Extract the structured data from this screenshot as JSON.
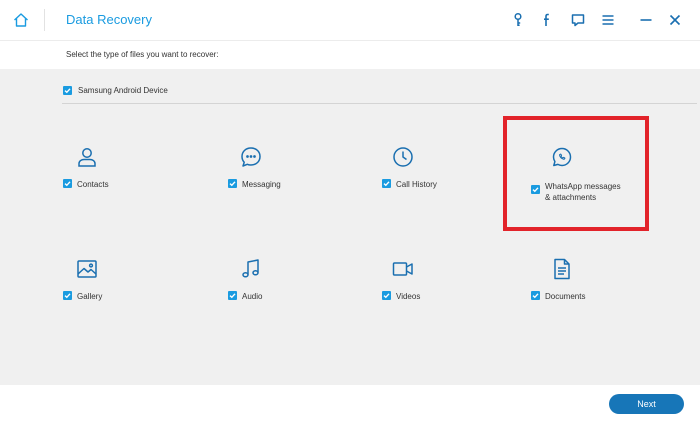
{
  "window": {
    "title": "Data Recovery",
    "icons": [
      "home-icon",
      "key-icon",
      "facebook-icon",
      "feedback-icon",
      "menu-icon",
      "minimize-icon",
      "close-icon"
    ]
  },
  "subheader": {
    "text": "Select the type of files you want to recover:"
  },
  "device": {
    "label": "Samsung Android Device",
    "checked": true
  },
  "categories": [
    {
      "label": "Contacts",
      "icon": "contact-icon",
      "checked": true
    },
    {
      "label": "Messaging",
      "icon": "messaging-icon",
      "checked": true
    },
    {
      "label": "Call History",
      "icon": "clock-icon",
      "checked": true
    },
    {
      "label_line1": "WhatsApp messages",
      "label_line2": "& attachments",
      "icon": "whatsapp-icon",
      "checked": true
    },
    {
      "label": "Gallery",
      "icon": "gallery-icon",
      "checked": true
    },
    {
      "label": "Audio",
      "icon": "music-note-icon",
      "checked": true
    },
    {
      "label": "Videos",
      "icon": "video-camera-icon",
      "checked": true
    },
    {
      "label": "Documents",
      "icon": "document-icon",
      "checked": true
    }
  ],
  "footer": {
    "next_label": "Next"
  },
  "colors": {
    "accent": "#1a9be0",
    "button": "#1776b8",
    "highlight": "#e2232a"
  }
}
